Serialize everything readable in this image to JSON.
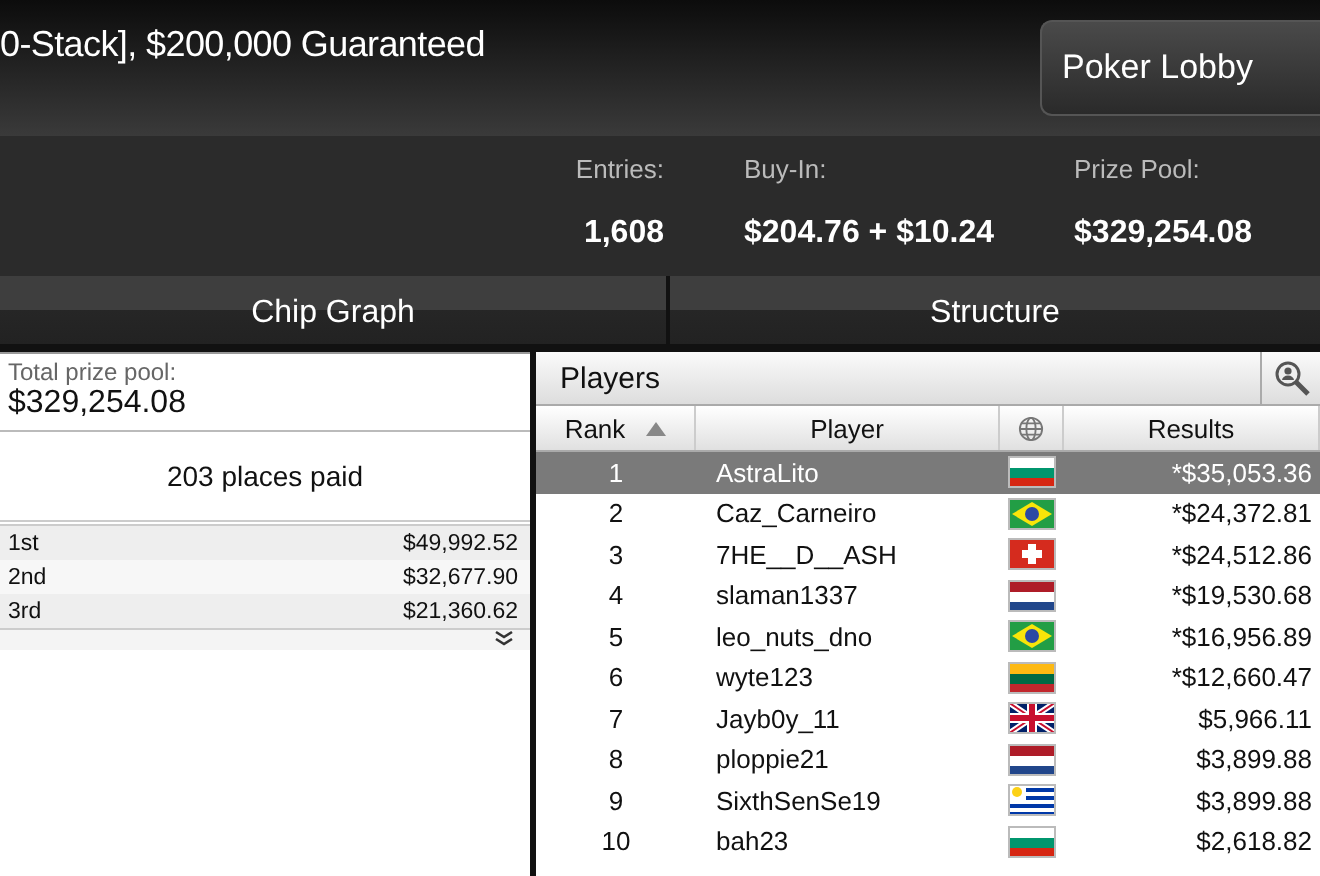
{
  "header": {
    "title": "0-Stack], $200,000 Guaranteed",
    "lobby_button": "Poker Lobby"
  },
  "stats": [
    {
      "label": "Entries:",
      "value": "1,608"
    },
    {
      "label": "Buy-In:",
      "value": "$204.76 + $10.24"
    },
    {
      "label": "Prize Pool:",
      "value": "$329,254.08"
    }
  ],
  "tabs": [
    {
      "label": "Chip Graph",
      "selected": false
    },
    {
      "label": "Structure",
      "selected": false
    }
  ],
  "prizes": {
    "total_label": "Total prize pool:",
    "total": "$329,254.08",
    "places_paid": "203 places paid",
    "rows": [
      {
        "place": "1st",
        "amount": "$49,992.52"
      },
      {
        "place": "2nd",
        "amount": "$32,677.90"
      },
      {
        "place": "3rd",
        "amount": "$21,360.62"
      }
    ]
  },
  "players": {
    "title": "Players",
    "columns": [
      "Rank",
      "Player",
      "Results"
    ],
    "rows": [
      {
        "rank": "1",
        "name": "AstraLito",
        "kind": "bg",
        "result": "*$35,053.36",
        "selected": true
      },
      {
        "rank": "2",
        "name": "Caz_Carneiro",
        "kind": "br",
        "result": "*$24,372.81",
        "selected": false
      },
      {
        "rank": "3",
        "name": "7HE__D__ASH",
        "kind": "ch",
        "result": "*$24,512.86",
        "selected": false
      },
      {
        "rank": "4",
        "name": "slaman1337",
        "kind": "nl",
        "result": "*$19,530.68",
        "selected": false
      },
      {
        "rank": "5",
        "name": "leo_nuts_dno",
        "kind": "br",
        "result": "*$16,956.89",
        "selected": false
      },
      {
        "rank": "6",
        "name": "wyte123",
        "kind": "lt",
        "result": "*$12,660.47",
        "selected": false
      },
      {
        "rank": "7",
        "name": "Jayb0y_11",
        "kind": "gb",
        "result": "$5,966.11",
        "selected": false
      },
      {
        "rank": "8",
        "name": "ploppie21",
        "kind": "nl",
        "result": "$3,899.88",
        "selected": false
      },
      {
        "rank": "9",
        "name": "SixthSenSe19",
        "kind": "uy",
        "result": "$3,899.88",
        "selected": false
      },
      {
        "rank": "10",
        "name": "bah23",
        "kind": "bg",
        "result": "$2,618.82",
        "selected": false
      }
    ]
  }
}
